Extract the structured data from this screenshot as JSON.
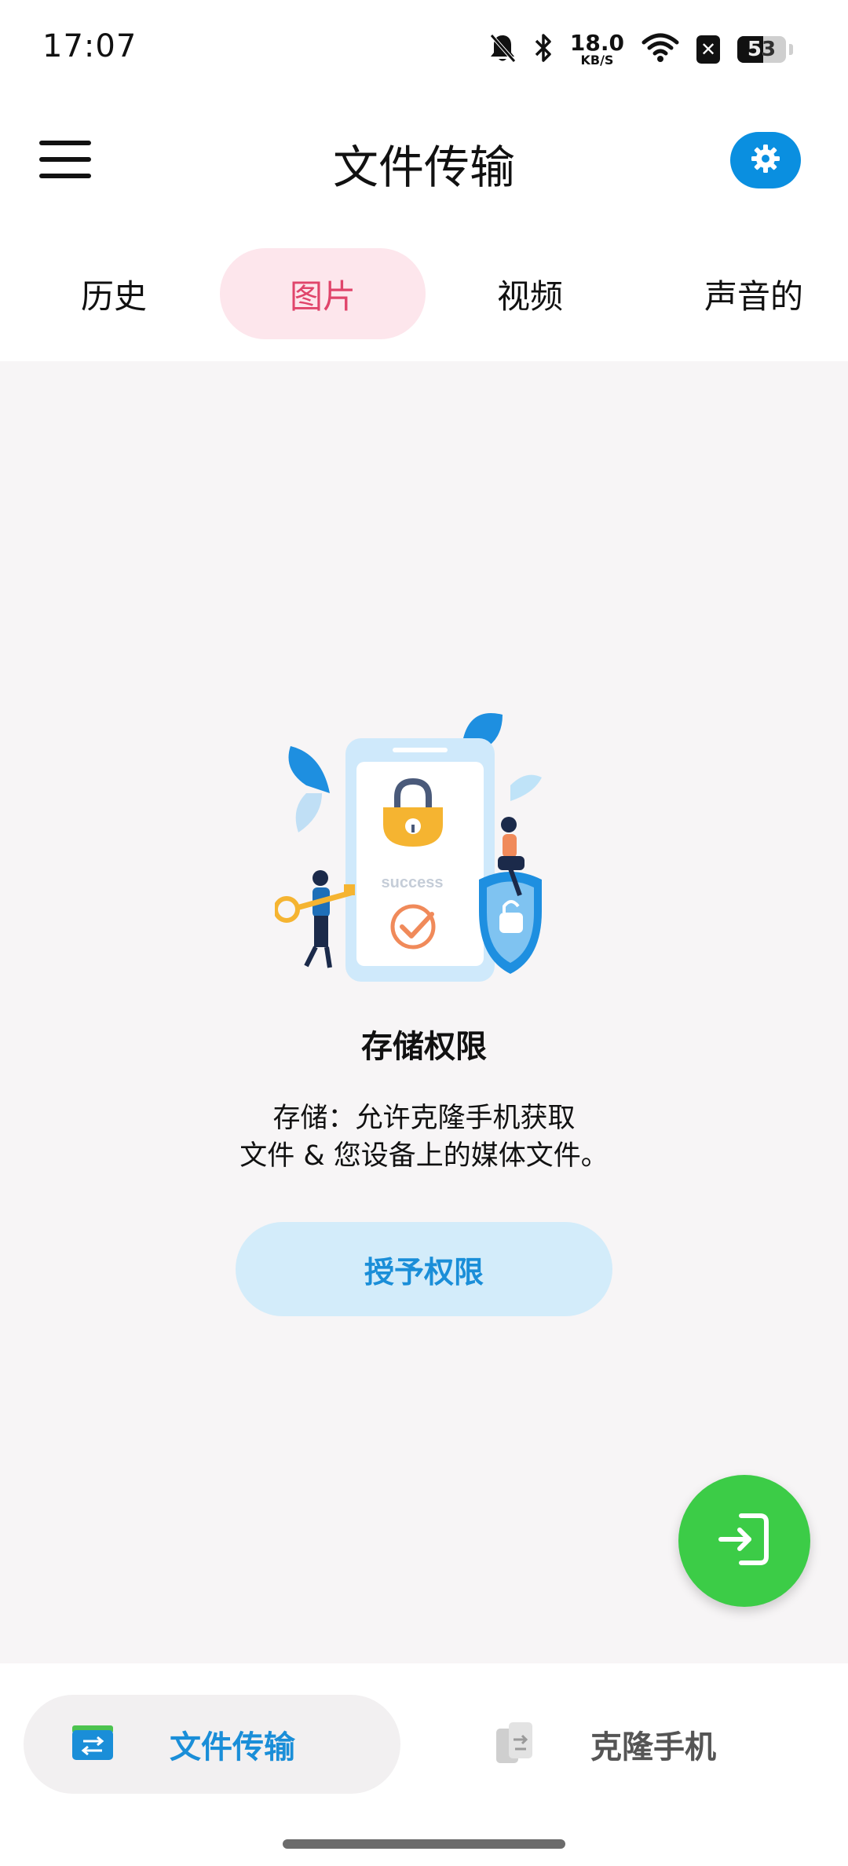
{
  "status_bar": {
    "time": "17:07",
    "net_speed_value": "18.0",
    "net_speed_unit": "KB/S",
    "battery_level": "53",
    "icons": [
      "mute-bell-icon",
      "bluetooth-icon",
      "wifi-icon",
      "close-badge-icon",
      "battery-icon"
    ]
  },
  "app_bar": {
    "title": "文件传输",
    "menu_icon": "hamburger-menu-icon",
    "settings_icon": "gear-icon"
  },
  "tabs": [
    {
      "label": "历史",
      "active": false
    },
    {
      "label": "图片",
      "active": true
    },
    {
      "label": "视频",
      "active": false
    },
    {
      "label": "声音的",
      "active": false
    }
  ],
  "permission": {
    "illustration_text": "success",
    "title": "存储权限",
    "description_line1": "存储：允许克隆手机获取",
    "description_line2": "文件 & 您设备上的媒体文件。",
    "grant_button": "授予权限"
  },
  "fab": {
    "icon": "import-icon"
  },
  "bottom_nav": [
    {
      "label": "文件传输",
      "icon": "folder-transfer-icon",
      "active": true
    },
    {
      "label": "克隆手机",
      "icon": "phone-clone-icon",
      "active": false
    }
  ],
  "colors": {
    "accent_blue": "#0a8fe0",
    "tab_active_bg": "#fde6ec",
    "tab_active_text": "#e0456b",
    "fab_green": "#3ccc47",
    "button_light_blue": "#d3ecfa"
  }
}
